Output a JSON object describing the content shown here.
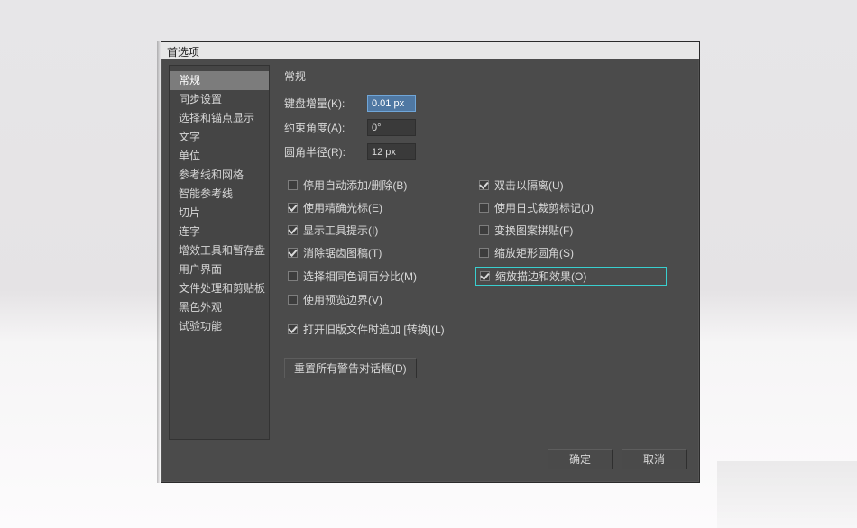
{
  "dialog": {
    "title": "首选项"
  },
  "sidebar": {
    "items": [
      "常规",
      "同步设置",
      "选择和锚点显示",
      "文字",
      "单位",
      "参考线和网格",
      "智能参考线",
      "切片",
      "连字",
      "增效工具和暂存盘",
      "用户界面",
      "文件处理和剪贴板",
      "黑色外观",
      "试验功能"
    ],
    "selected_index": 0
  },
  "panel": {
    "title": "常规",
    "fields": {
      "keyboard_increment": {
        "label": "键盘增量(K):",
        "value": "0.01 px"
      },
      "constraint_angle": {
        "label": "约束角度(A):",
        "value": "0°"
      },
      "corner_radius": {
        "label": "圆角半径(R):",
        "value": "12 px"
      }
    },
    "checks_left": [
      {
        "label": "停用自动添加/删除(B)",
        "checked": false
      },
      {
        "label": "使用精确光标(E)",
        "checked": true
      },
      {
        "label": "显示工具提示(I)",
        "checked": true
      },
      {
        "label": "消除锯齿图稿(T)",
        "checked": true
      },
      {
        "label": "选择相同色调百分比(M)",
        "checked": false
      },
      {
        "label": "使用预览边界(V)",
        "checked": false
      }
    ],
    "checks_right": [
      {
        "label": "双击以隔离(U)",
        "checked": true
      },
      {
        "label": "使用日式裁剪标记(J)",
        "checked": false
      },
      {
        "label": "变换图案拼贴(F)",
        "checked": false
      },
      {
        "label": "缩放矩形圆角(S)",
        "checked": false
      },
      {
        "label": "缩放描边和效果(O)",
        "checked": true,
        "highlight": true
      }
    ],
    "extra_check": {
      "label": "打开旧版文件时追加 [转换](L)",
      "checked": true
    },
    "reset_button": "重置所有警告对话框(D)"
  },
  "buttons": {
    "ok": "确定",
    "cancel": "取消"
  }
}
